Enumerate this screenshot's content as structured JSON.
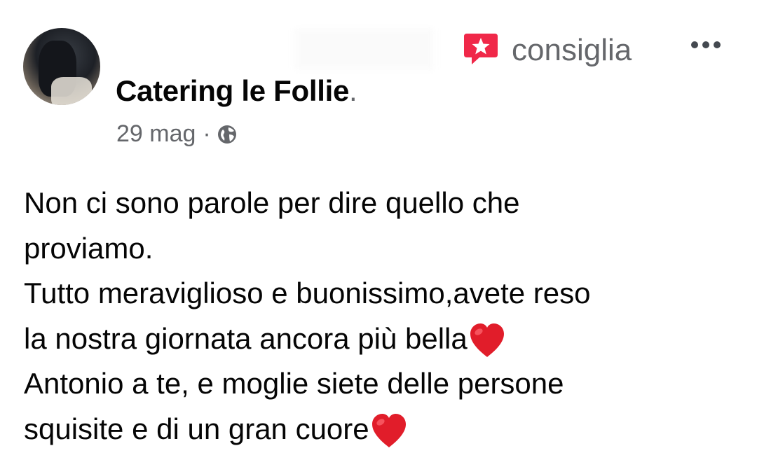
{
  "post": {
    "author": "Catering le Follie",
    "author_suffix": ".",
    "action_label": "consiglia",
    "date": "29 mag",
    "separator": "·",
    "icons": {
      "recommend": "recommend-star-icon",
      "more": "more-options-icon",
      "audience": "globe-icon",
      "heart": "red-heart-emoji"
    },
    "colors": {
      "recommend_accent": "#f02849",
      "secondary_text": "#65676b",
      "heart": "#e11d2a"
    },
    "body_lines": [
      "Non ci sono parole per dire quello che",
      "proviamo.",
      "Tutto meraviglioso e buonissimo,avete reso",
      "la nostra giornata ancora più bella",
      "Antonio a te, e moglie siete delle persone",
      "squisite e di un gran cuore"
    ]
  }
}
